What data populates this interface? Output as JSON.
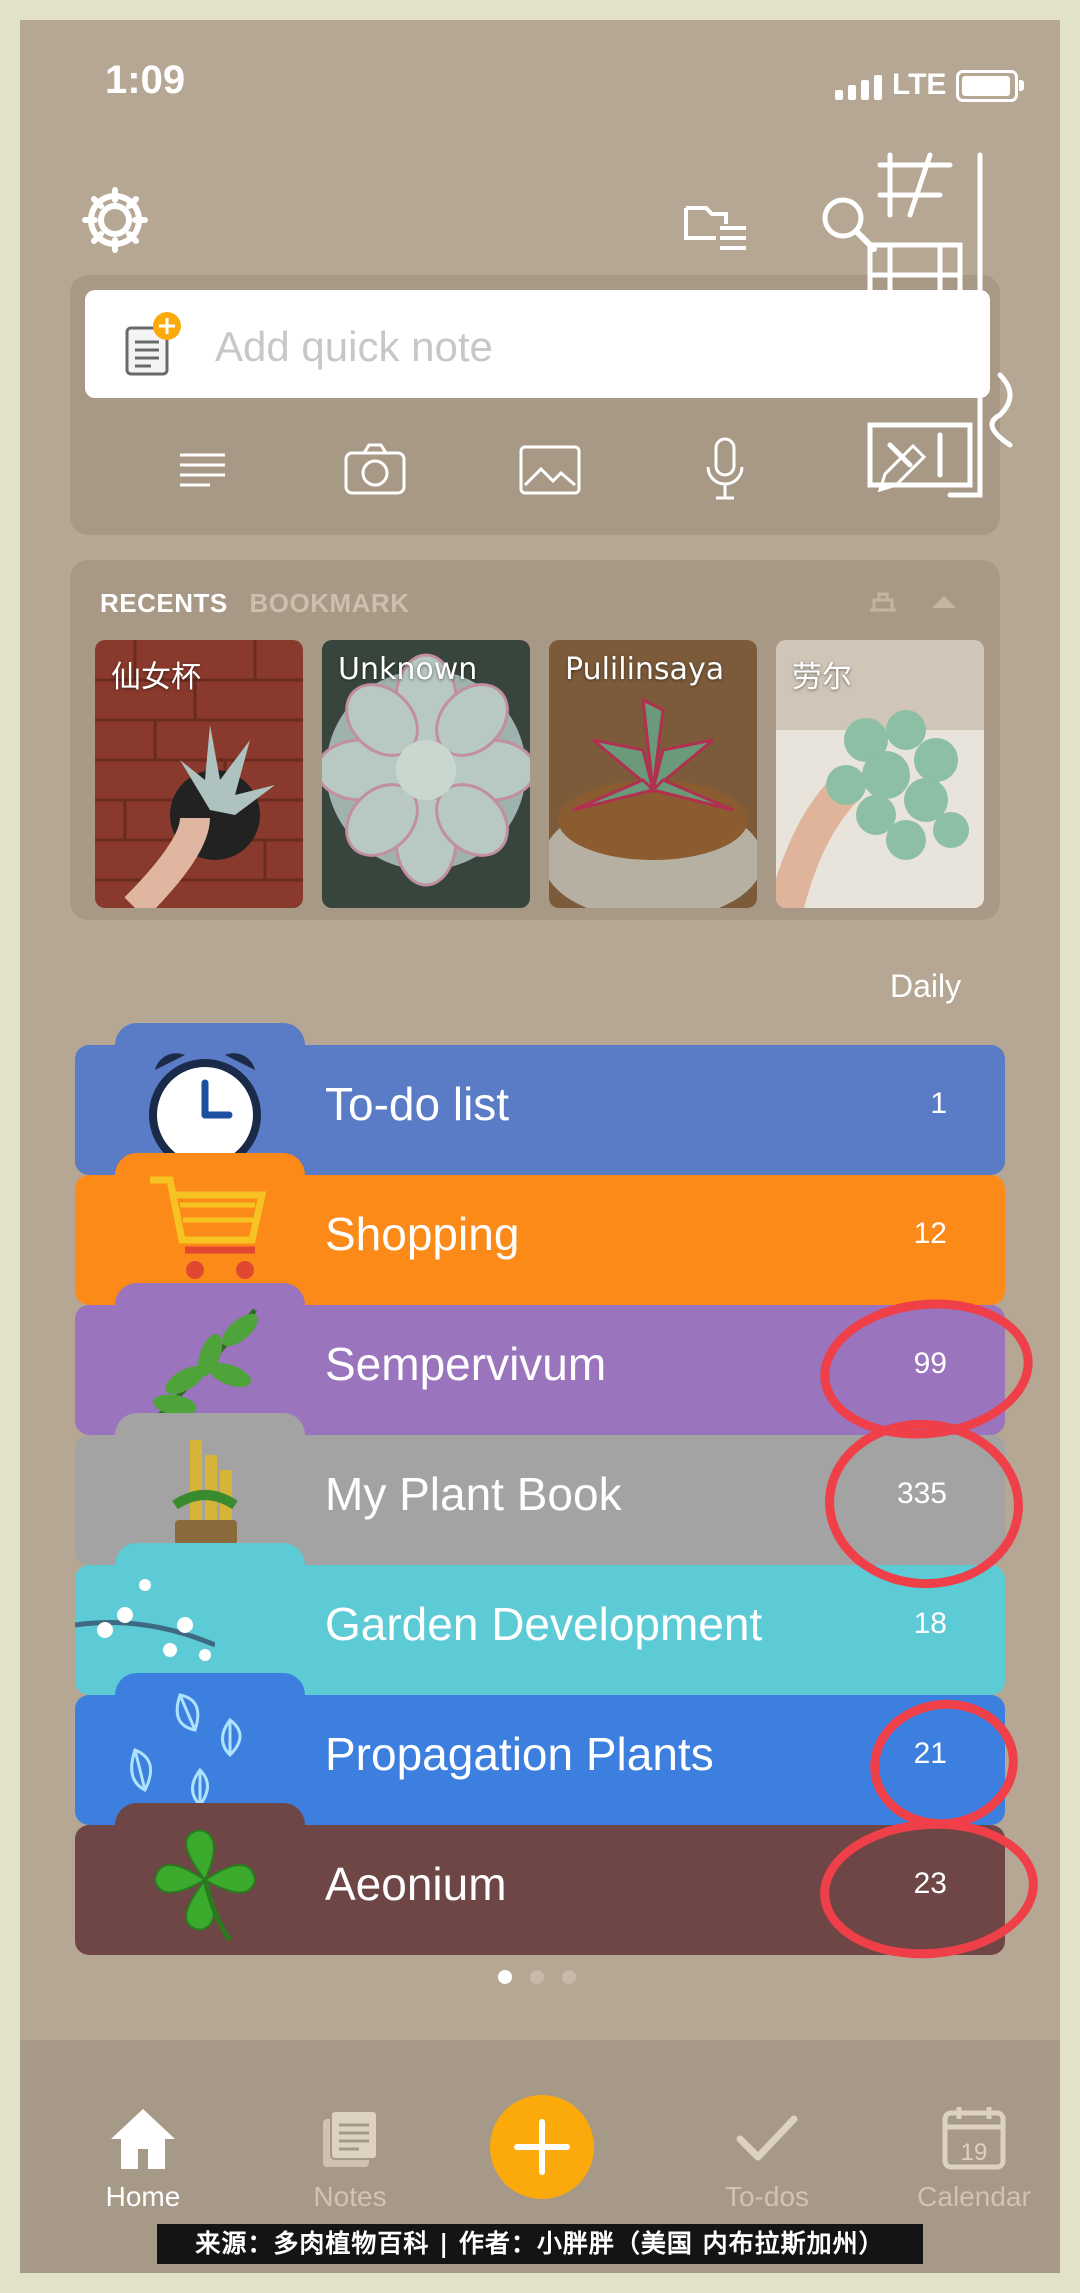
{
  "status": {
    "time": "1:09",
    "network": "LTE"
  },
  "top_icons": {
    "settings": "gear-icon",
    "folders": "folder-list-icon",
    "search": "search-icon"
  },
  "quick_note": {
    "placeholder": "Add quick note",
    "tools": [
      "text-list-icon",
      "camera-icon",
      "image-icon",
      "microphone-icon",
      "pen-icon"
    ]
  },
  "recents": {
    "tab_recents": "RECENTS",
    "tab_bookmark": "BOOKMARK",
    "cards": [
      {
        "label": "仙女杯"
      },
      {
        "label": "Unknown"
      },
      {
        "label": "Pulilinsaya"
      },
      {
        "label": "劳尔"
      }
    ]
  },
  "section_label": "Daily",
  "notebooks": [
    {
      "title": "To-do list",
      "count": "1",
      "color": "#5a7bc6",
      "icon": "alarm-clock-icon"
    },
    {
      "title": "Shopping",
      "count": "12",
      "color": "#fb8a18",
      "icon": "shopping-cart-icon"
    },
    {
      "title": "Sempervivum",
      "count": "99",
      "color": "#9a74bd",
      "icon": "leaf-branch-icon"
    },
    {
      "title": "My Plant Book",
      "count": "335",
      "color": "#a3a3a3",
      "icon": "bamboo-icon"
    },
    {
      "title": "Garden Development",
      "count": "18",
      "color": "#5ccbd6",
      "icon": "blossom-branch-icon"
    },
    {
      "title": "Propagation Plants",
      "count": "21",
      "color": "#3c7fde",
      "icon": "leaves-icon"
    },
    {
      "title": "Aeonium",
      "count": "23",
      "color": "#6e4646",
      "icon": "four-leaf-clover-icon"
    }
  ],
  "pager": {
    "pages": 3,
    "current": 1
  },
  "tabbar": {
    "home": "Home",
    "notes": "Notes",
    "todos": "To-dos",
    "calendar": "Calendar",
    "calendar_day": "19"
  },
  "credit": "来源：多肉植物百科 | 作者：小胖胖（美国 内布拉斯加州）",
  "stamp_text": "多肉植物百科"
}
